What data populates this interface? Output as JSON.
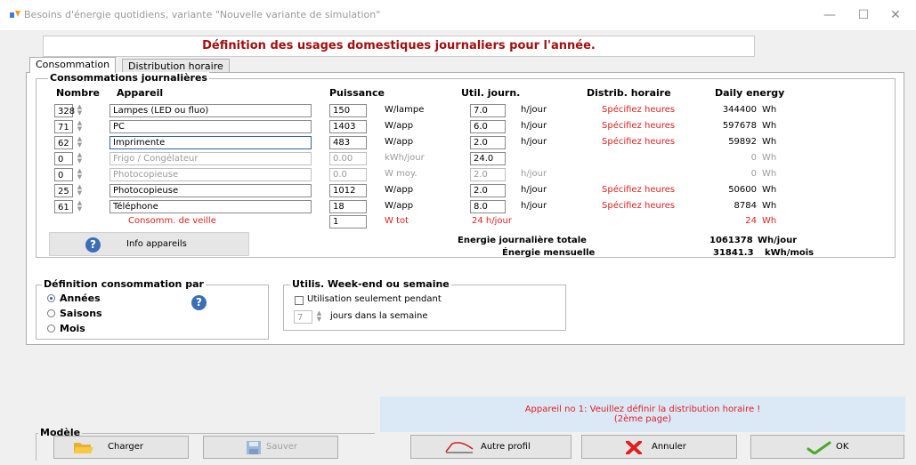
{
  "window": {
    "title": "Besoins d'énergie quotidiens, variante \"Nouvelle variante de simulation\"",
    "minimize": "—",
    "maximize": "☐",
    "close": "✕"
  },
  "header": "Définition des usages domestiques journaliers pour l'année.",
  "tabs": [
    "Consommation",
    "Distribution horaire"
  ],
  "consumption": {
    "group_title": "Consommations journalières",
    "columns": {
      "number": "Nombre",
      "device": "Appareil",
      "power": "Puissance",
      "usage": "Util. journ.",
      "distribution": "Distrib. horaire",
      "daily_energy": "Daily energy"
    },
    "rows": [
      {
        "number": "328",
        "device": "Lampes (LED ou fluo)",
        "power": "150",
        "power_unit": "W/lampe",
        "usage": "7.0",
        "usage_unit": "h/jour",
        "distribution": "Spécifiez heures",
        "energy": "344400",
        "energy_unit": "Wh"
      },
      {
        "number": "71",
        "device": "PC",
        "power": "1403",
        "power_unit": "W/app",
        "usage": "6.0",
        "usage_unit": "h/jour",
        "distribution": "Spécifiez heures",
        "energy": "597678",
        "energy_unit": "Wh"
      },
      {
        "number": "62",
        "device": "Imprimente",
        "power": "483",
        "power_unit": "W/app",
        "usage": "2.0",
        "usage_unit": "h/jour",
        "distribution": "Spécifiez heures",
        "energy": "59892",
        "energy_unit": "Wh"
      },
      {
        "number": "0",
        "device": "Frigo / Congélateur",
        "power": "0.00",
        "power_unit": "kWh/jour",
        "usage": "24.0",
        "usage_unit": "",
        "distribution": "",
        "energy": "0",
        "energy_unit": "Wh"
      },
      {
        "number": "0",
        "device": "Photocopieuse",
        "power": "0.0",
        "power_unit": "W moy.",
        "usage": "2.0",
        "usage_unit": "h/jour",
        "distribution": "",
        "energy": "0",
        "energy_unit": "Wh"
      },
      {
        "number": "25",
        "device": "Photocopieuse",
        "power": "1012",
        "power_unit": "W/app",
        "usage": "2.0",
        "usage_unit": "h/jour",
        "distribution": "Spécifiez heures",
        "energy": "50600",
        "energy_unit": "Wh"
      },
      {
        "number": "61",
        "device": "Téléphone",
        "power": "18",
        "power_unit": "W/app",
        "usage": "8.0",
        "usage_unit": "h/jour",
        "distribution": "Spécifiez heures",
        "energy": "8784",
        "energy_unit": "Wh"
      }
    ],
    "standby": {
      "label": "Consomm. de veille",
      "power": "1",
      "power_unit": "W tot",
      "usage": "24 h/jour",
      "energy": "24",
      "energy_unit": "Wh"
    },
    "info_button": "Info appareils",
    "totals": {
      "daily_label": "Energie journalière totale",
      "daily_value": "1061378",
      "daily_unit": "Wh/jour",
      "monthly_label": "Énergie mensuelle",
      "monthly_value": "31841.3",
      "monthly_unit": "kWh/mois"
    }
  },
  "definition": {
    "title": "Définition consommation par",
    "options": [
      "Années",
      "Saisons",
      "Mois"
    ],
    "selected": "Années"
  },
  "weekend": {
    "title": "Utilis. Week-end ou semaine",
    "checkbox_label": "Utilisation seulement pendant",
    "days_value": "7",
    "days_label": "jours dans la semaine"
  },
  "model": {
    "title": "Modèle",
    "load": "Charger",
    "save": "Sauver"
  },
  "message": {
    "line1": "Appareil no 1: Veuillez définir la distribution horaire !",
    "line2": "(2ème page)"
  },
  "buttons": {
    "other_profile": "Autre profil",
    "cancel": "Annuler",
    "ok": "OK"
  },
  "icons": [
    "app-icon",
    "help-icon",
    "folder-icon",
    "floppy-icon",
    "profile-curve-icon",
    "cancel-x-icon",
    "check-icon"
  ]
}
